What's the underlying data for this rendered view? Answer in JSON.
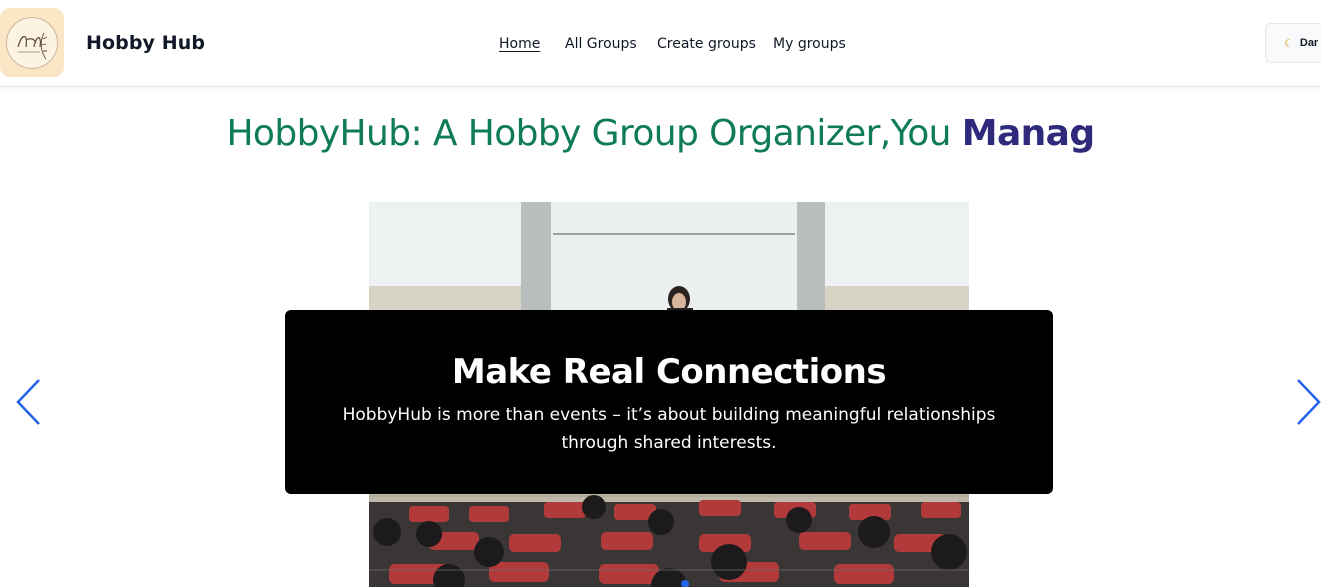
{
  "header": {
    "brand": "Hobby Hub",
    "logo_icon": "hobby-hub-logo",
    "nav": [
      {
        "label": "Home",
        "active": true
      },
      {
        "label": "All Groups",
        "active": false
      },
      {
        "label": "Create groups",
        "active": false
      },
      {
        "label": "My groups",
        "active": false
      }
    ],
    "theme_toggle": {
      "label": "Dar",
      "icon": "moon-icon"
    }
  },
  "hero": {
    "title_static": "HobbyHub: A Hobby Group Organizer,You ",
    "title_typed": "Manag",
    "colors": {
      "static": "#0f7b57",
      "typed": "#2f2a7c"
    }
  },
  "carousel": {
    "slide": {
      "title": "Make Real Connections",
      "text": "HobbyHub is more than events – it’s about building meaningful relationships through shared interests."
    },
    "prev_icon": "chevron-left-icon",
    "next_icon": "chevron-right-icon",
    "active_index": 1,
    "arrow_color": "#2563eb"
  }
}
